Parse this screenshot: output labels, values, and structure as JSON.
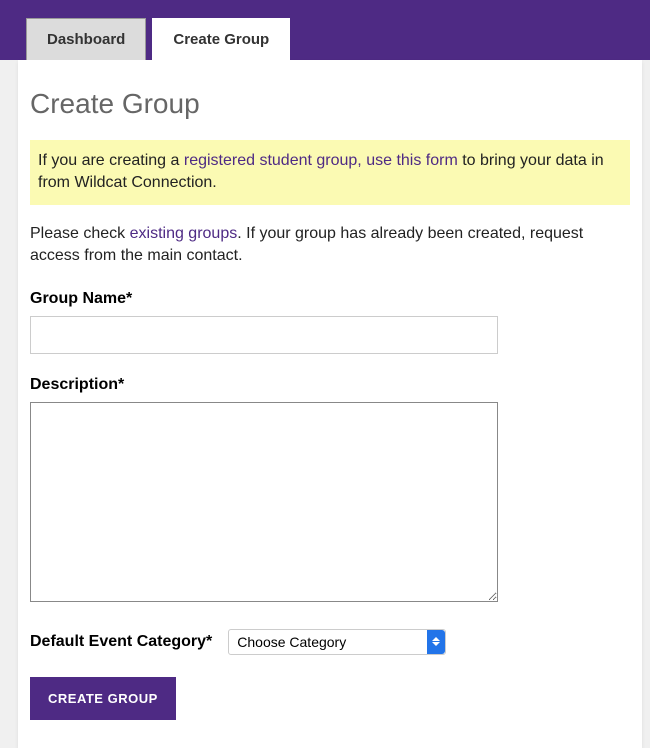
{
  "tabs": {
    "dashboard": "Dashboard",
    "create_group": "Create Group"
  },
  "page": {
    "title": "Create Group"
  },
  "notice": {
    "prefix": "If you are creating a ",
    "link": "registered student group, use this form",
    "suffix": " to bring your data in from Wildcat Connection."
  },
  "info": {
    "prefix": "Please check ",
    "link": "existing groups",
    "suffix": ". If your group has already been created, request access from the main contact."
  },
  "form": {
    "group_name_label": "Group Name*",
    "group_name_value": "",
    "description_label": "Description*",
    "description_value": "",
    "category_label": "Default Event Category*",
    "category_selected": "Choose Category",
    "submit_label": "CREATE GROUP"
  }
}
